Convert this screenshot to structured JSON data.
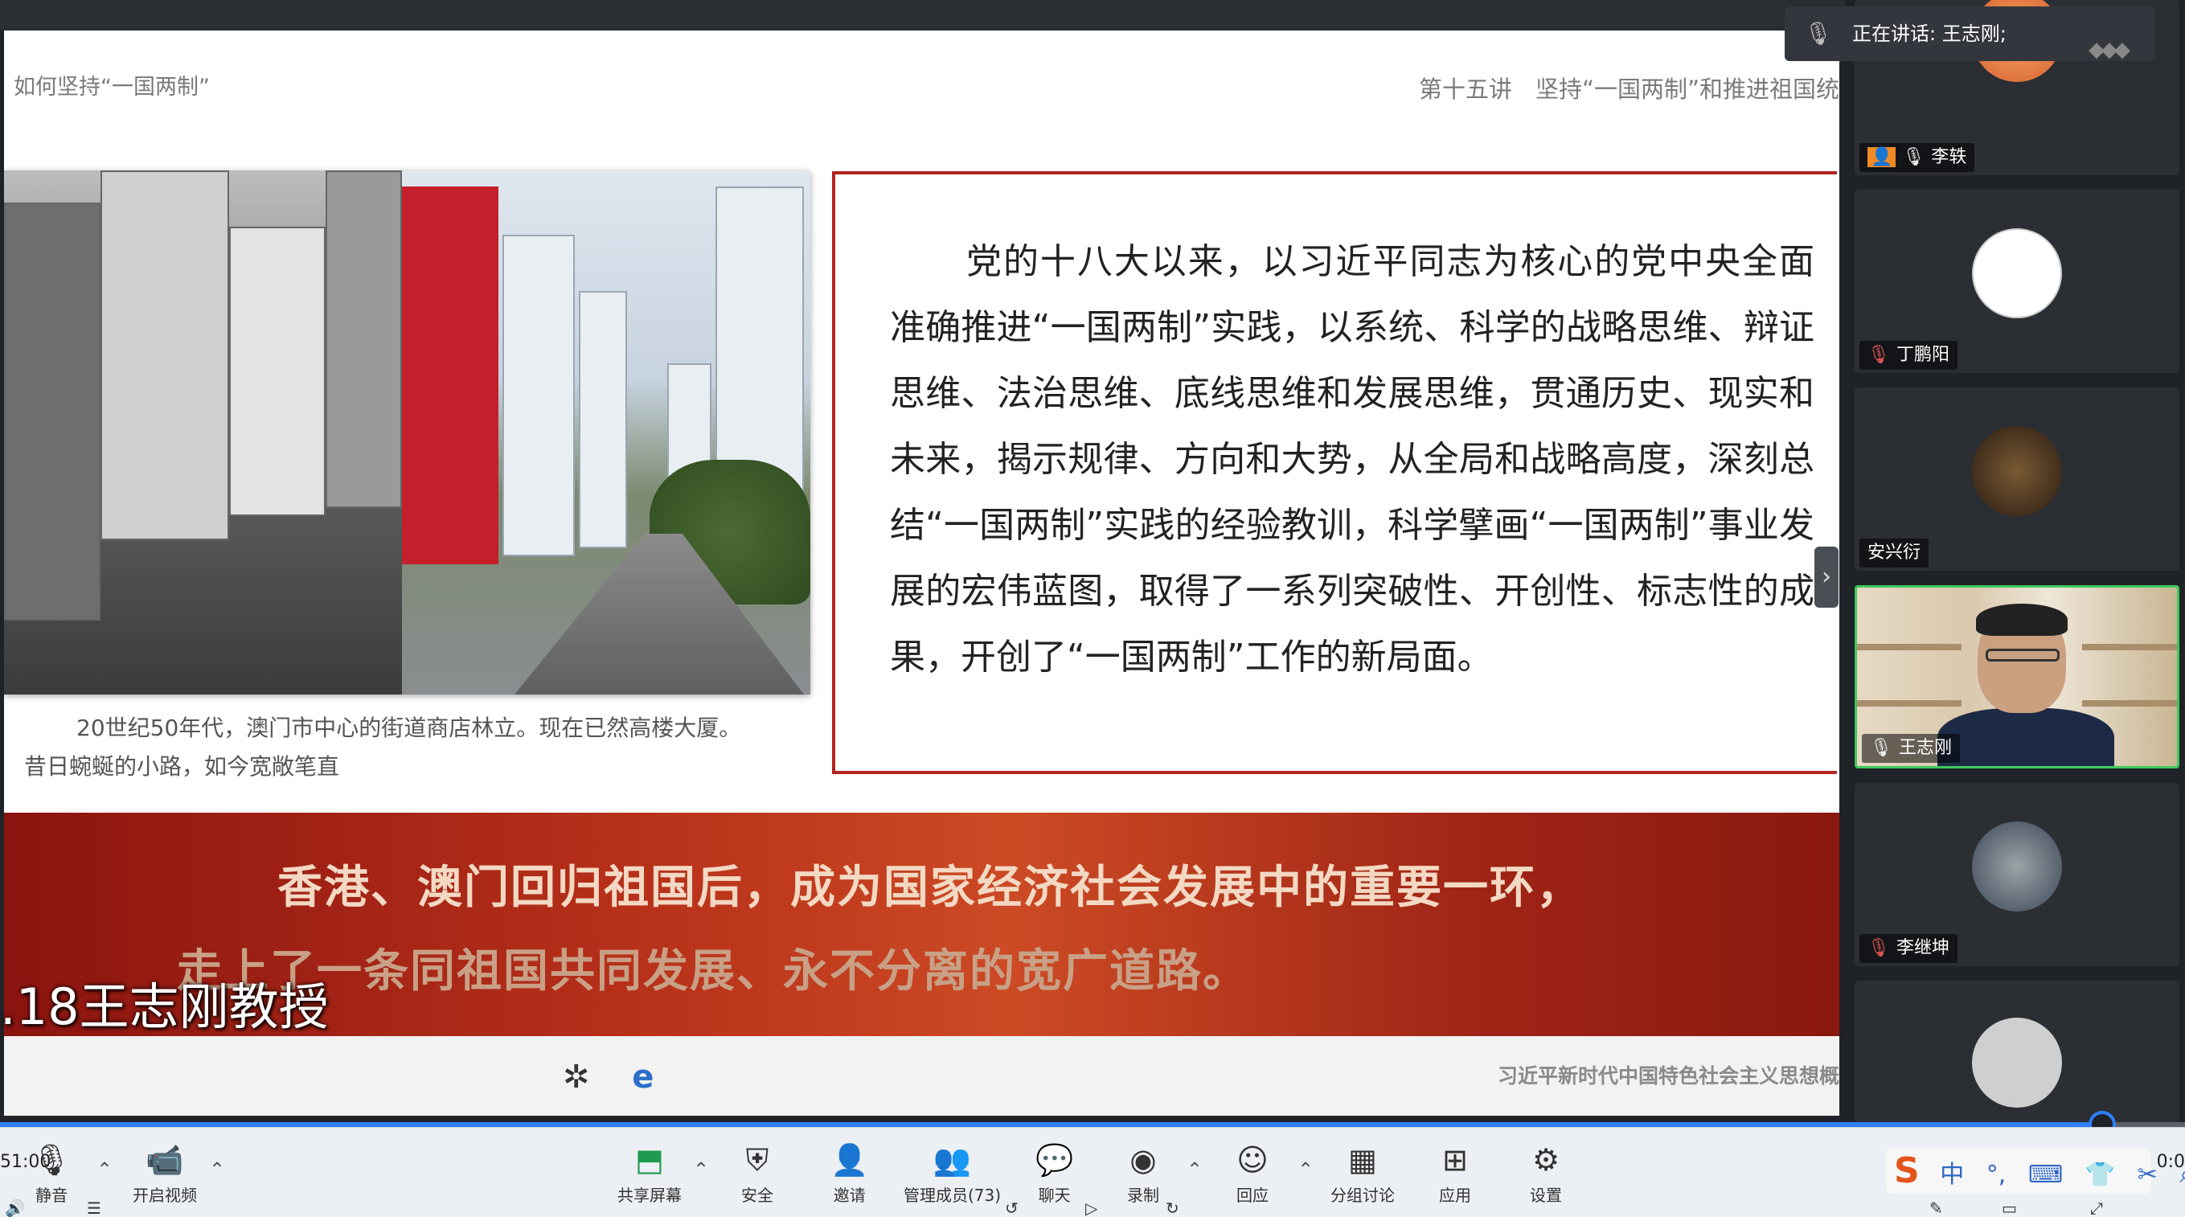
{
  "slide": {
    "header_left": "如何坚持“一国两制”",
    "header_right": "第十五讲　坚持“一国两制”和推进祖国统",
    "photo_caption_line1": "20世纪50年代，澳门市中心的街道商店林立。现在已然高楼大厦。",
    "photo_caption_line2": "昔日蜿蜒的小路，如今宽敞笔直",
    "body_text": "党的十八大以来，以习近平同志为核心的党中央全面准确推进“一国两制”实践，以系统、科学的战略思维、辩证思维、法治思维、底线思维和发展思维，贯通历史、现实和未来，揭示规律、方向和大势，从全局和战略高度，深刻总结“一国两制”实践的经验教训，科学擘画“一国两制”事业发展的宏伟蓝图，取得了一系列突破性、开创性、标志性的成果，开创了“一国两制”工作的新局面。",
    "banner_line1": "香港、澳门回归祖国后，成为国家经济社会发展中的重要一环，",
    "banner_line2": "走上了一条同祖国共同发展、永不分离的宽广道路。",
    "footer_text": "习近平新时代中国特色社会主义思想概",
    "footer_icons": [
      "windmill-icon",
      "ie-icon"
    ]
  },
  "overlay": {
    "presenter_caption": ".18王志刚教授"
  },
  "speaking_bar": {
    "label": "正在讲话: 王志刚;"
  },
  "participants": [
    {
      "name": "李轶",
      "avatar_color": "#e07a3a",
      "mic": "on"
    },
    {
      "name": "丁鹏阳",
      "avatar_color": "#ffffff",
      "mic": "muted"
    },
    {
      "name": "安兴衍",
      "avatar_color": "#3a2a1e",
      "mic": "none"
    },
    {
      "name": "王志刚",
      "mic": "on",
      "active": true
    },
    {
      "name": "李继坤",
      "avatar_color": "#4a5a6e",
      "mic": "muted"
    }
  ],
  "playback": {
    "time_left": "51:00",
    "time_right": "0:0",
    "progress_fraction": 0.962
  },
  "toolbar": {
    "mute": "静音",
    "video": "开启视频",
    "share": "共享屏幕",
    "security": "安全",
    "invite": "邀请",
    "manage": "管理成员(73)",
    "chat": "聊天",
    "record": "录制",
    "reactions": "回应",
    "breakout": "分组讨论",
    "apps": "应用",
    "settings": "设置"
  },
  "ime": {
    "logo": "S",
    "lang": "中"
  },
  "colors": {
    "accent_red": "#b2241f",
    "active_green": "#3ec95c",
    "progress_blue": "#2d7ff9"
  }
}
